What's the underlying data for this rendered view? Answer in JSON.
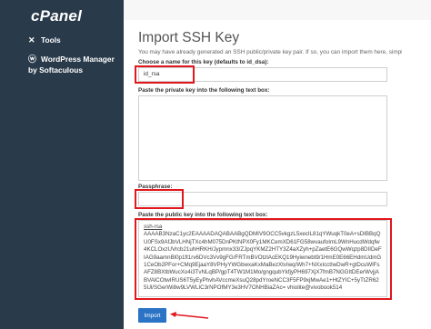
{
  "brand": {
    "logo_text": "cPanel"
  },
  "sidebar": {
    "items": [
      {
        "label": "Tools",
        "icon": "tools-icon"
      },
      {
        "label": "WordPress Manager by Softaculous",
        "icon": "wordpress-icon"
      }
    ]
  },
  "page": {
    "title": "Import SSH Key",
    "intro": "You may have already generated an SSH public/private key pair. If so, you can import them here, simply"
  },
  "form": {
    "name_label": "Choose a name for this key (defaults to id_dsa):",
    "name_value": "id_rsa",
    "private_label": "Paste the private key into the following text box:",
    "private_value": "",
    "passphrase_label": "Passphrase:",
    "passphrase_value": "",
    "public_label": "Paste the public key into the following text box:",
    "public_head": "ssh-rsa",
    "public_value": "AAAAB3NzaC1yc2EAAAADAQABAABgQDMIV9OCC5vkgzL5xecIL81qYWuqkT0eA+sDIBBqQU0FSx9AfJbVLHNjTXc4hM075DnPKtNPX0Fy1MKCemXD61FG58wvaufoImL9WnHucdWdqfw4KCLOxzUVrcb21uhHRKH/Jypmnx33/ZJpqYKMZ2HTY3Z4aXZyh+pZaetE6GQwWqzp8DIIDeFIAG9aamnBl0p1ft1rv6DVc3Vv9gFG/FRTmBVOtzlAcEKQ19Hyiwnebt9/1HmE0E66EHdmUdmG1CeOb2PFor+CMq9EjaaY8VPHyYWGbwxaKxMaBezXtvIwq/Wh7+NXxIcctIwDwR+gtDcuWlFsAFZ8BXtbWucXo4i3TvNLqBP/gpT4TW1M1Mo/gngqubYkfjyPH697XjX7fmB7NGGItDEerWvjjABVAlCOtwIRUS6T5yEyPhvhAVccmeXsuQ28pdYroeNCC3F5FP9xjMwAe1+HtZYIC+5yTtZR625Ul/SGerWi8w9LVWLIC3rNPOfMY3e3HV7ONHBiaZAc= vhiolite@vivobook514"
  },
  "buttons": {
    "import_label": "Import"
  },
  "colors": {
    "sidebar": "#293a4a",
    "highlight": "#e0171c",
    "primary": "#2a73c5"
  }
}
